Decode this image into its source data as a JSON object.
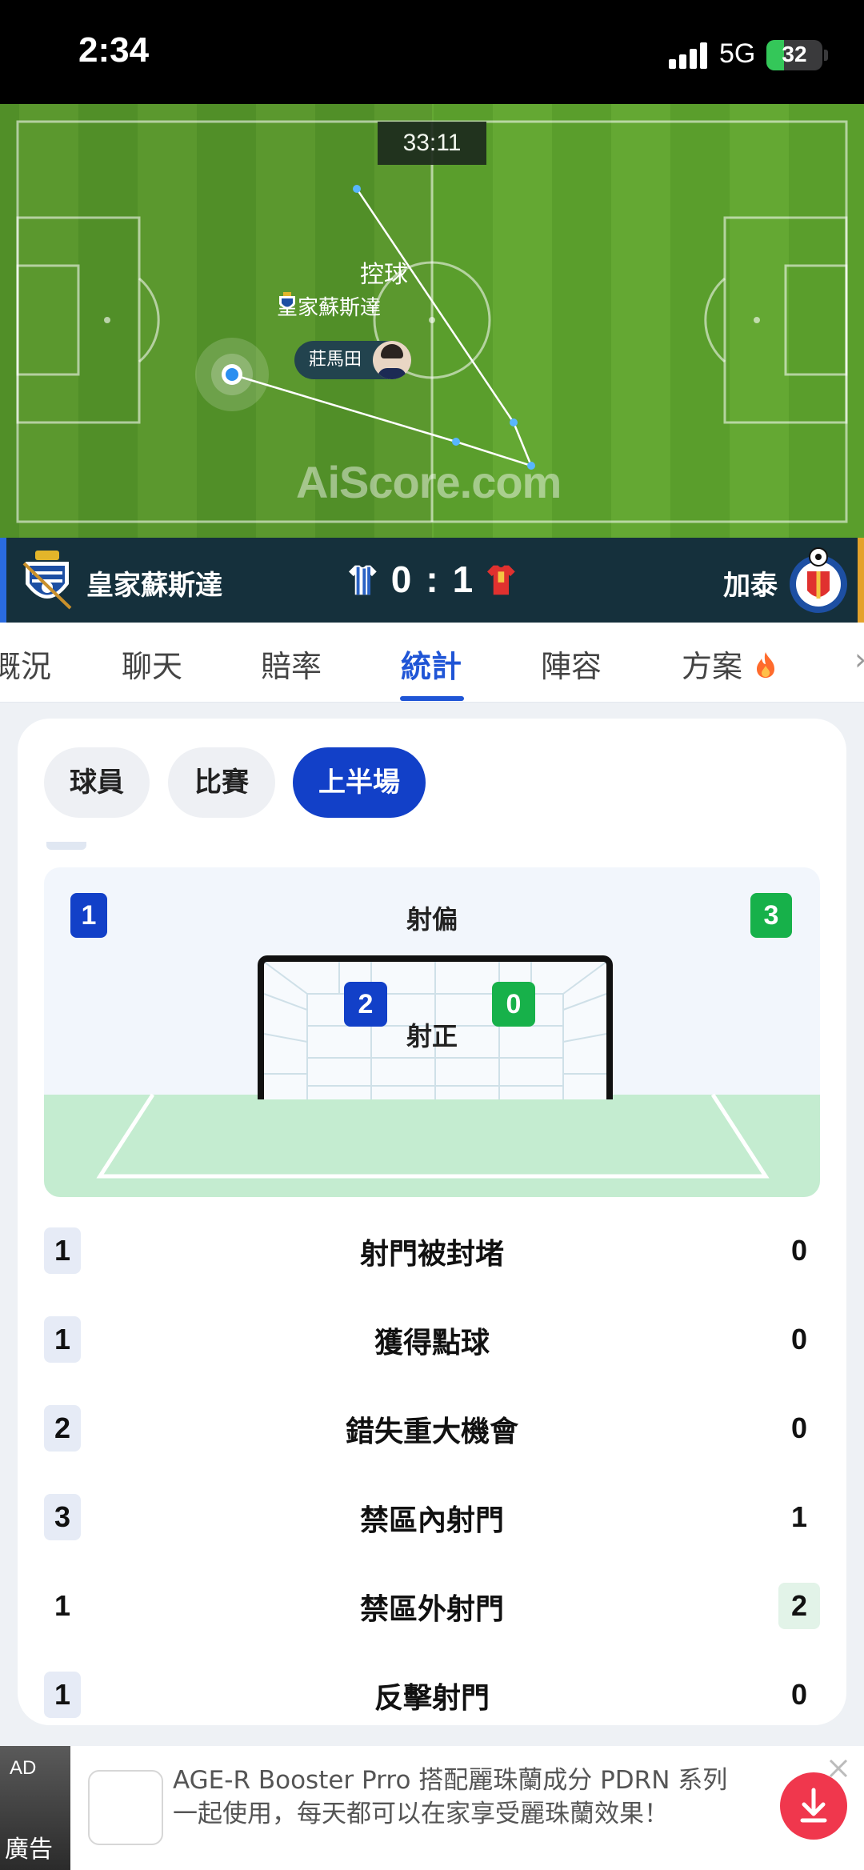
{
  "status_bar": {
    "time": "2:34",
    "network": "5G",
    "battery": "32",
    "battery_level": 0.32
  },
  "pitch": {
    "clock": "33:11",
    "possession_label": "控球",
    "possession_team": "皇家蘇斯達",
    "player": "莊馬田",
    "watermark": "AiScore.com"
  },
  "match": {
    "home_team": "皇家蘇斯達",
    "away_team": "加泰",
    "home_score": "0",
    "separator": ":",
    "away_score": "1"
  },
  "tabs": [
    {
      "label": "概況",
      "active": false
    },
    {
      "label": "聊天",
      "active": false
    },
    {
      "label": "賠率",
      "active": false
    },
    {
      "label": "統計",
      "active": true
    },
    {
      "label": "陣容",
      "active": false
    },
    {
      "label": "方案",
      "active": false,
      "icon": "fire-icon"
    }
  ],
  "filters": [
    {
      "label": "球員",
      "active": false
    },
    {
      "label": "比賽",
      "active": false
    },
    {
      "label": "上半場",
      "active": true
    }
  ],
  "goal_stats": {
    "off_target": {
      "label": "射偏",
      "home": "1",
      "away": "3"
    },
    "on_target": {
      "label": "射正",
      "home": "2",
      "away": "0"
    }
  },
  "stats": [
    {
      "label": "射門被封堵",
      "home": "1",
      "away": "0",
      "leader": "home"
    },
    {
      "label": "獲得點球",
      "home": "1",
      "away": "0",
      "leader": "home"
    },
    {
      "label": "錯失重大機會",
      "home": "2",
      "away": "0",
      "leader": "home"
    },
    {
      "label": "禁區內射門",
      "home": "3",
      "away": "1",
      "leader": "home"
    },
    {
      "label": "禁區外射門",
      "home": "1",
      "away": "2",
      "leader": "away"
    },
    {
      "label": "反擊射門",
      "home": "1",
      "away": "0",
      "leader": "home"
    }
  ],
  "ad": {
    "tag": "AD",
    "tag_label": "廣告",
    "text": "AGE-R Booster Prro 搭配麗珠蘭成分 PDRN 系列一起使用，每天都可以在家享受麗珠蘭效果！"
  },
  "colors": {
    "accent": "#1f55d6",
    "home_badge": "#1240c8",
    "away_badge": "#17b14a",
    "pitch": "#5a9e2c",
    "score_bar": "#15303c"
  }
}
